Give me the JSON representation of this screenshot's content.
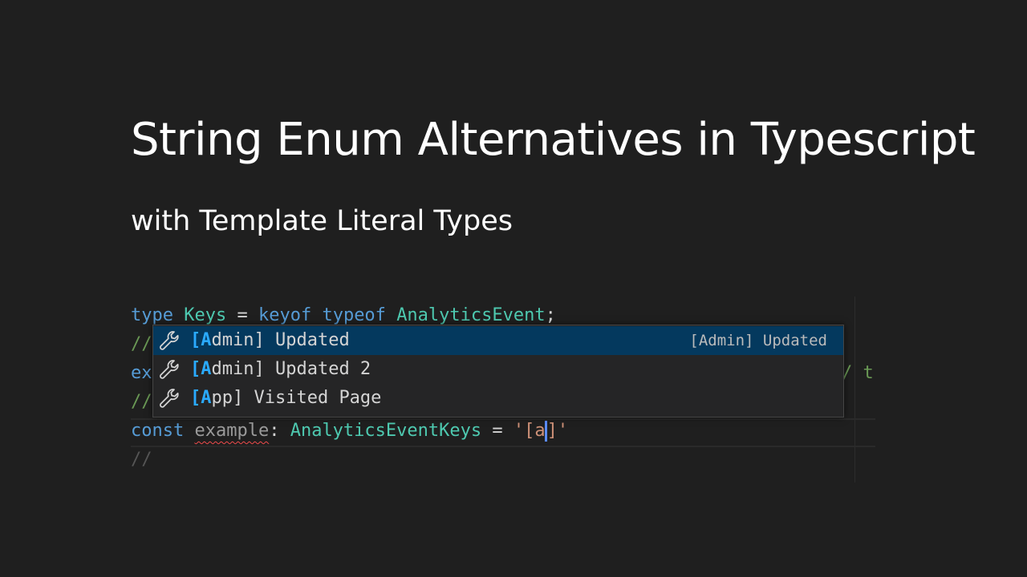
{
  "title": "String Enum Alternatives in Typescript",
  "subtitle": "with Template Literal Types",
  "code": {
    "line1": {
      "kw1": "type",
      "name": "Keys",
      "eq": " = ",
      "kw2": "keyof",
      "kw3": "typeof",
      "type": "AnalyticsEvent",
      "end": ";"
    },
    "line2": {
      "text": "//"
    },
    "line3": {
      "left": "ex",
      "right": "/ t"
    },
    "line4": {
      "text": "//"
    },
    "line5": {
      "kw": "const",
      "var": "example",
      "colon": ": ",
      "type": "AnalyticsEventKeys",
      "eq": " = ",
      "str_open": "'[a",
      "str_close": "]'"
    },
    "line6": {
      "text": "//"
    }
  },
  "suggestions": {
    "items": [
      {
        "match": "[A",
        "rest": "dmin] Updated",
        "detail": "[Admin] Updated",
        "icon": "wrench-icon",
        "selected": true
      },
      {
        "match": "[A",
        "rest": "dmin] Updated 2",
        "icon": "wrench-icon"
      },
      {
        "match": "[A",
        "rest": "pp] Visited Page",
        "icon": "wrench-icon"
      }
    ]
  },
  "colors": {
    "background": "#1f1f1f",
    "keyword": "#569cd6",
    "type": "#4ec9b0",
    "string": "#ce9178",
    "comment": "#6a9955",
    "selection": "#04395e",
    "match_highlight": "#2aaaff"
  }
}
